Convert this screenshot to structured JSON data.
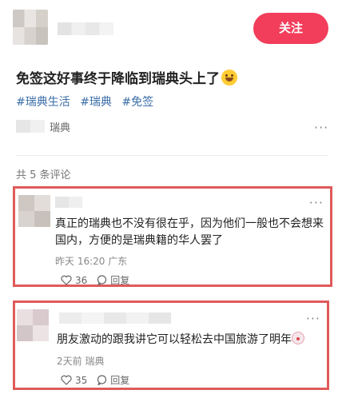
{
  "post": {
    "follow_label": "关注",
    "title": "免签这好事终于降临到瑞典头上了",
    "title_emoji": "laughing-face-emoji",
    "tags": [
      "#瑞典生活",
      "#瑞典",
      "#免签"
    ],
    "location": "瑞典",
    "more": "···"
  },
  "comments": {
    "count_label": "共 5 条评论",
    "items": [
      {
        "text": "真正的瑞典也不没有很在乎，因为他们一般也不会想来国内，方便的是瑞典籍的华人罢了",
        "meta": "昨天 16:20 广东",
        "likes": "36",
        "reply_label": "回复",
        "more": "···"
      },
      {
        "text": "朋友激动的跟我讲它可以轻松去中国旅游了明年",
        "text_emoji": "clown-face-emoji",
        "meta": "2天前 瑞典",
        "likes": "35",
        "reply_label": "回复",
        "more": "···"
      }
    ]
  },
  "colors": {
    "accent": "#f23d5b",
    "tag": "#3b6ea8",
    "highlight_border": "#e05a5a"
  }
}
